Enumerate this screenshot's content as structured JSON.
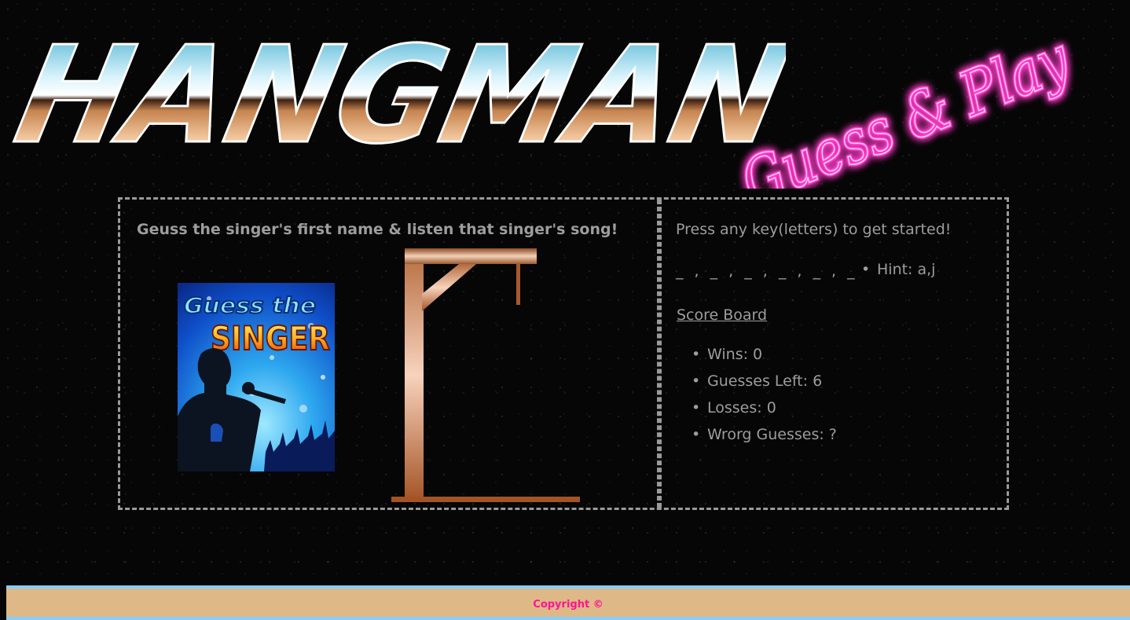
{
  "logo": {
    "title": "HANGMAN",
    "subtitle": "Guess & Play"
  },
  "game": {
    "instruction": "Geuss the singer's first name & listen that singer's song!",
    "image": {
      "line1": "Guess the",
      "line2": "SINGER"
    },
    "start_message": "Press any key(letters) to get started!",
    "word_blanks": "_ , _ , _ , _ , _ , _",
    "hint": "Hint: a,j"
  },
  "scoreboard": {
    "title": "Score Board",
    "items": [
      "Wins: 0",
      "Guesses Left: 6",
      "Losses: 0",
      "Wrorg Guesses: ?"
    ]
  },
  "footer": {
    "copyright": "Copyright ©"
  },
  "colors": {
    "background": "#060606",
    "panel_border": "#9a9a9a",
    "text": "#9d9d9d",
    "footer_bg": "#deb887",
    "footer_border": "#87cefa",
    "neon_pink": "#ff1493"
  }
}
